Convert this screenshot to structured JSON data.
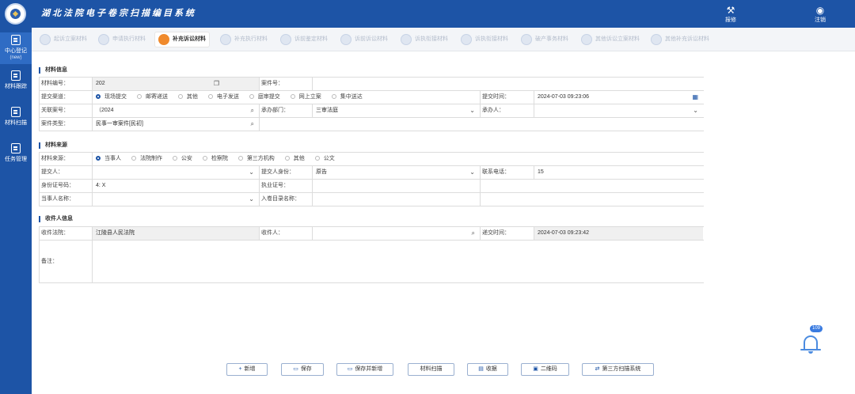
{
  "header": {
    "title": "湖北法院电子卷宗扫描编目系统",
    "tools": [
      {
        "icon": "wrench-hammer-icon",
        "label": "报修"
      },
      {
        "icon": "user-icon",
        "label": "注销"
      }
    ]
  },
  "sidebar": {
    "items": [
      {
        "icon": "document-icon",
        "label": "中心登记",
        "sub": "(new)"
      },
      {
        "icon": "book-icon",
        "label": "材料跟踪",
        "sub": ""
      },
      {
        "icon": "scanner-icon",
        "label": "材料扫描",
        "sub": ""
      },
      {
        "icon": "task-icon",
        "label": "任务管理",
        "sub": ""
      }
    ]
  },
  "tabs": [
    {
      "label": "起诉立案材料",
      "active": false
    },
    {
      "label": "申请执行材料",
      "active": false
    },
    {
      "label": "补充诉讼材料",
      "active": true
    },
    {
      "label": "补充执行材料",
      "active": false
    },
    {
      "label": "诉前鉴定材料",
      "active": false
    },
    {
      "label": "诉前诉讼材料",
      "active": false
    },
    {
      "label": "诉执衔接材料",
      "active": false
    },
    {
      "label": "诉执衔接材料",
      "active": false
    },
    {
      "label": "破产事务材料",
      "active": false
    },
    {
      "label": "其他诉讼立案材料",
      "active": false
    },
    {
      "label": "其他补充诉讼材料",
      "active": false
    }
  ],
  "material_info": {
    "section": "材料信息",
    "material_no_label": "材料编号：",
    "material_no_value": "202",
    "case_no_label": "案件号：",
    "case_no_value": "",
    "channel_label": "提交渠道：",
    "channels": [
      {
        "label": "现场提交",
        "checked": true
      },
      {
        "label": "邮寄递送",
        "checked": false
      },
      {
        "label": "其他",
        "checked": false
      },
      {
        "label": "电子发送",
        "checked": false
      },
      {
        "label": "庭审提交",
        "checked": false
      },
      {
        "label": "网上立案",
        "checked": false
      },
      {
        "label": "集中送达",
        "checked": false
      }
    ],
    "submit_time_label": "提交时间：",
    "submit_time_value": "2024-07-03 09:23:06",
    "related_case_label": "关联案号：",
    "related_case_value": "（2024",
    "dept_label": "承办部门：",
    "dept_value": "三审法庭",
    "handler_label": "承办人：",
    "handler_value": "",
    "case_type_label": "案件类型：",
    "case_type_value": "民事一审案件[民初]"
  },
  "material_source": {
    "section": "材料来源",
    "source_label": "材料来源：",
    "sources": [
      {
        "label": "当事人",
        "checked": true
      },
      {
        "label": "法院制作",
        "checked": false
      },
      {
        "label": "公安",
        "checked": false
      },
      {
        "label": "检察院",
        "checked": false
      },
      {
        "label": "第三方机构",
        "checked": false
      },
      {
        "label": "其他",
        "checked": false
      },
      {
        "label": "公文",
        "checked": false
      }
    ],
    "submitter_label": "提交人：",
    "submitter_value": "",
    "identity_label": "提交人身份：",
    "identity_value": "原告",
    "phone_label": "联系电话：",
    "phone_value": "15",
    "id_no_label": "身份证号码：",
    "id_no_value": "4:                          X",
    "license_label": "执业证号：",
    "license_value": "",
    "party_label": "当事人名称：",
    "party_value": "",
    "catalog_label": "入卷目录名称：",
    "catalog_value": ""
  },
  "receiver_info": {
    "section": "收件人信息",
    "court_label": "收件法院：",
    "court_value": "江陵县人民法院",
    "receiver_label": "收件人：",
    "receiver_value": "",
    "handover_label": "递交时间：",
    "handover_value": "2024-07-03 09:23:42",
    "remark_label": "备注："
  },
  "buttons": [
    {
      "icon": "plus-icon",
      "label": "新增"
    },
    {
      "icon": "save-icon",
      "label": "保存"
    },
    {
      "icon": "save-icon",
      "label": "保存并新增"
    },
    {
      "icon": "scan-icon",
      "label": "材料扫描"
    },
    {
      "icon": "receipt-icon",
      "label": "收据"
    },
    {
      "icon": "qrcode-icon",
      "label": "二维码"
    },
    {
      "icon": "transfer-icon",
      "label": "第三方扫描系统"
    }
  ],
  "notification": {
    "icon": "bell-icon",
    "count": "109"
  }
}
